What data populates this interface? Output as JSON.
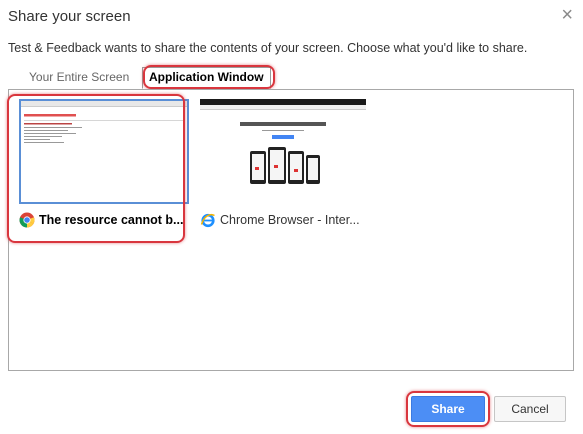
{
  "dialog": {
    "title": "Share your screen",
    "close_symbol": "×",
    "description": "Test & Feedback wants to share the contents of your screen. Choose what you'd like to share."
  },
  "tabs": [
    {
      "label": "Your Entire Screen",
      "selected": false
    },
    {
      "label": "Application Window",
      "selected": true
    }
  ],
  "windows": [
    {
      "label": "The resource cannot b...",
      "icon": "chrome-icon",
      "selected": true,
      "preview": {
        "heading": "Server Error in '/' Application."
      }
    },
    {
      "label": "Chrome Browser - Inter...",
      "icon": "internet-explorer-icon",
      "selected": false,
      "preview": {
        "heading": "Get a fast, free web browser"
      }
    }
  ],
  "buttons": {
    "share": "Share",
    "cancel": "Cancel"
  },
  "colors": {
    "highlight": "#d9363e",
    "primary": "#4c8ef5",
    "selection_border": "#5a8fd6"
  }
}
